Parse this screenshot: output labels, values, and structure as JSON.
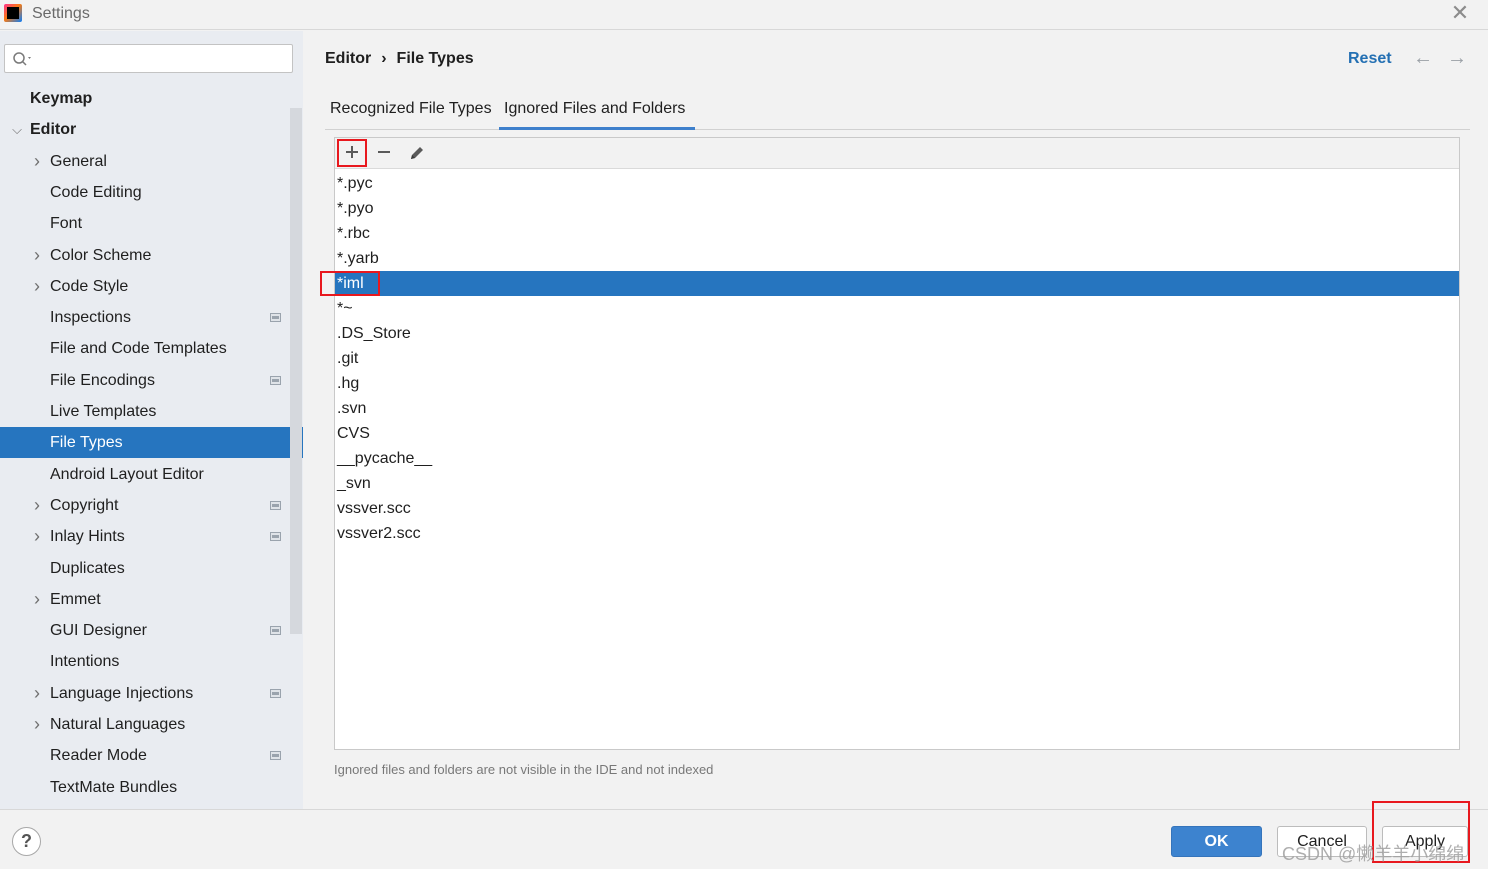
{
  "window": {
    "title": "Settings"
  },
  "sidebar": {
    "search_placeholder": "",
    "items": [
      {
        "label": "Keymap",
        "level": 0,
        "bold": true,
        "arrow": "",
        "project": false,
        "selected": false
      },
      {
        "label": "Editor",
        "level": 0,
        "bold": true,
        "arrow": "expanded",
        "project": false,
        "selected": false
      },
      {
        "label": "General",
        "level": 1,
        "bold": false,
        "arrow": "collapsed",
        "project": false,
        "selected": false
      },
      {
        "label": "Code Editing",
        "level": 1,
        "bold": false,
        "arrow": "",
        "project": false,
        "selected": false
      },
      {
        "label": "Font",
        "level": 1,
        "bold": false,
        "arrow": "",
        "project": false,
        "selected": false
      },
      {
        "label": "Color Scheme",
        "level": 1,
        "bold": false,
        "arrow": "collapsed",
        "project": false,
        "selected": false
      },
      {
        "label": "Code Style",
        "level": 1,
        "bold": false,
        "arrow": "collapsed",
        "project": false,
        "selected": false
      },
      {
        "label": "Inspections",
        "level": 1,
        "bold": false,
        "arrow": "",
        "project": true,
        "selected": false
      },
      {
        "label": "File and Code Templates",
        "level": 1,
        "bold": false,
        "arrow": "",
        "project": false,
        "selected": false
      },
      {
        "label": "File Encodings",
        "level": 1,
        "bold": false,
        "arrow": "",
        "project": true,
        "selected": false
      },
      {
        "label": "Live Templates",
        "level": 1,
        "bold": false,
        "arrow": "",
        "project": false,
        "selected": false
      },
      {
        "label": "File Types",
        "level": 1,
        "bold": false,
        "arrow": "",
        "project": false,
        "selected": true
      },
      {
        "label": "Android Layout Editor",
        "level": 1,
        "bold": false,
        "arrow": "",
        "project": false,
        "selected": false
      },
      {
        "label": "Copyright",
        "level": 1,
        "bold": false,
        "arrow": "collapsed",
        "project": true,
        "selected": false
      },
      {
        "label": "Inlay Hints",
        "level": 1,
        "bold": false,
        "arrow": "collapsed",
        "project": true,
        "selected": false
      },
      {
        "label": "Duplicates",
        "level": 1,
        "bold": false,
        "arrow": "",
        "project": false,
        "selected": false
      },
      {
        "label": "Emmet",
        "level": 1,
        "bold": false,
        "arrow": "collapsed",
        "project": false,
        "selected": false
      },
      {
        "label": "GUI Designer",
        "level": 1,
        "bold": false,
        "arrow": "",
        "project": true,
        "selected": false
      },
      {
        "label": "Intentions",
        "level": 1,
        "bold": false,
        "arrow": "",
        "project": false,
        "selected": false
      },
      {
        "label": "Language Injections",
        "level": 1,
        "bold": false,
        "arrow": "collapsed",
        "project": true,
        "selected": false
      },
      {
        "label": "Natural Languages",
        "level": 1,
        "bold": false,
        "arrow": "collapsed",
        "project": false,
        "selected": false
      },
      {
        "label": "Reader Mode",
        "level": 1,
        "bold": false,
        "arrow": "",
        "project": true,
        "selected": false
      },
      {
        "label": "TextMate Bundles",
        "level": 1,
        "bold": false,
        "arrow": "",
        "project": false,
        "selected": false
      }
    ]
  },
  "header": {
    "breadcrumb": [
      "Editor",
      "File Types"
    ],
    "breadcrumb_sep": "›",
    "reset_label": "Reset",
    "back_icon": "arrow-left-icon",
    "forward_icon": "arrow-right-icon"
  },
  "tabs": [
    {
      "label": "Recognized File Types",
      "active": false
    },
    {
      "label": "Ignored Files and Folders",
      "active": true
    }
  ],
  "ignored": {
    "toolbar": {
      "add_icon": "plus-icon",
      "remove_icon": "minus-icon",
      "edit_icon": "pencil-icon"
    },
    "items": [
      "*.pyc",
      "*.pyo",
      "*.rbc",
      "*.yarb",
      "*iml",
      "*~",
      ".DS_Store",
      ".git",
      ".hg",
      ".svn",
      "CVS",
      "__pycache__",
      "_svn",
      "vssver.scc",
      "vssver2.scc"
    ],
    "selected_index": 4,
    "hint": "Ignored files and folders are not visible in the IDE and not indexed"
  },
  "footer": {
    "help_label": "?",
    "ok_label": "OK",
    "cancel_label": "Cancel",
    "apply_label": "Apply",
    "watermark": "CSDN @懒羊羊小绵绵"
  },
  "colors": {
    "selection": "#2675bf",
    "link": "#2470b3",
    "annotation": "#e8181e",
    "primary_button": "#3d83cf"
  }
}
